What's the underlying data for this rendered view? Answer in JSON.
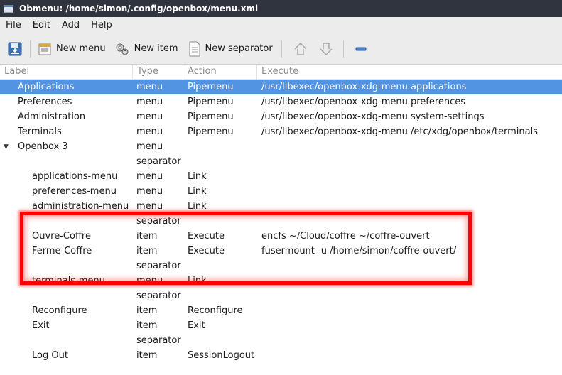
{
  "window": {
    "title": "Obmenu: /home/simon/.config/openbox/menu.xml"
  },
  "menubar": {
    "items": [
      "File",
      "Edit",
      "Add",
      "Help"
    ]
  },
  "toolbar": {
    "new_menu": "New menu",
    "new_item": "New item",
    "new_separator": "New separator"
  },
  "columns": {
    "label": "Label",
    "type": "Type",
    "action": "Action",
    "execute": "Execute"
  },
  "rows": [
    {
      "label": "Applications",
      "type": "menu",
      "action": "Pipemenu",
      "execute": "/usr/libexec/openbox-xdg-menu applications",
      "depth": 0
    },
    {
      "label": "Preferences",
      "type": "menu",
      "action": "Pipemenu",
      "execute": "/usr/libexec/openbox-xdg-menu preferences",
      "depth": 0
    },
    {
      "label": "Administration",
      "type": "menu",
      "action": "Pipemenu",
      "execute": "/usr/libexec/openbox-xdg-menu system-settings",
      "depth": 0
    },
    {
      "label": "Terminals",
      "type": "menu",
      "action": "Pipemenu",
      "execute": "/usr/libexec/openbox-xdg-menu /etc/xdg/openbox/terminals",
      "depth": 0
    },
    {
      "label": "Openbox 3",
      "type": "menu",
      "action": "",
      "execute": "",
      "depth": 0
    },
    {
      "label": "",
      "type": "separator",
      "action": "",
      "execute": "",
      "depth": 1
    },
    {
      "label": "applications-menu",
      "type": "menu",
      "action": "Link",
      "execute": "",
      "depth": 1
    },
    {
      "label": "preferences-menu",
      "type": "menu",
      "action": "Link",
      "execute": "",
      "depth": 1
    },
    {
      "label": "administration-menu",
      "type": "menu",
      "action": "Link",
      "execute": "",
      "depth": 1
    },
    {
      "label": "",
      "type": "separator",
      "action": "",
      "execute": "",
      "depth": 1
    },
    {
      "label": "Ouvre-Coffre",
      "type": "item",
      "action": "Execute",
      "execute": "encfs ~/Cloud/coffre ~/coffre-ouvert",
      "depth": 1
    },
    {
      "label": "Ferme-Coffre",
      "type": "item",
      "action": "Execute",
      "execute": "fusermount -u /home/simon/coffre-ouvert/",
      "depth": 1
    },
    {
      "label": "",
      "type": "separator",
      "action": "",
      "execute": "",
      "depth": 1
    },
    {
      "label": "terminals-menu",
      "type": "menu",
      "action": "Link",
      "execute": "",
      "depth": 1
    },
    {
      "label": "",
      "type": "separator",
      "action": "",
      "execute": "",
      "depth": 1
    },
    {
      "label": "Reconfigure",
      "type": "item",
      "action": "Reconfigure",
      "execute": "",
      "depth": 1
    },
    {
      "label": "Exit",
      "type": "item",
      "action": "Exit",
      "execute": "",
      "depth": 1
    },
    {
      "label": "",
      "type": "separator",
      "action": "",
      "execute": "",
      "depth": 1
    },
    {
      "label": "Log Out",
      "type": "item",
      "action": "SessionLogout",
      "execute": "",
      "depth": 1
    }
  ],
  "colors": {
    "selection": "#5294e2",
    "highlight": "#ff0000",
    "titlebar": "#2f343f"
  }
}
